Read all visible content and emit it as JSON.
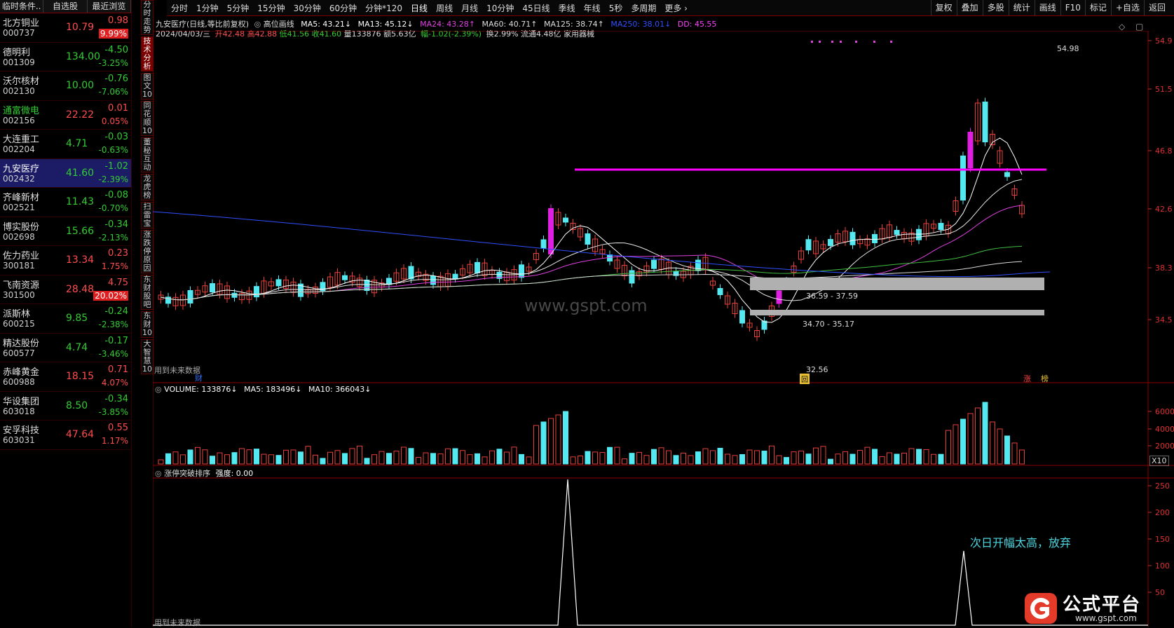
{
  "watchlist": {
    "tabs": [
      "临时条件..",
      "自选股",
      "最近浏览"
    ],
    "rows": [
      {
        "name": "北方铜业",
        "code": "000737",
        "price": "10.79",
        "change": "0.98",
        "pct": "9.99%",
        "dir": "up",
        "pct_highlight": true
      },
      {
        "name": "德明利",
        "code": "001309",
        "price": "134.00",
        "change": "-4.50",
        "pct": "-3.25%",
        "dir": "dn"
      },
      {
        "name": "沃尔核材",
        "code": "002130",
        "price": "10.00",
        "change": "-0.76",
        "pct": "-7.06%",
        "dir": "dn"
      },
      {
        "name": "通富微电",
        "code": "002156",
        "price": "22.22",
        "change": "0.01",
        "pct": "0.05%",
        "dir": "up",
        "name_green": true
      },
      {
        "name": "大连重工",
        "code": "002204",
        "price": "4.71",
        "change": "-0.03",
        "pct": "-0.63%",
        "dir": "dn"
      },
      {
        "name": "九安医疗",
        "code": "002432",
        "price": "41.60",
        "change": "-1.02",
        "pct": "-2.39%",
        "dir": "dn",
        "selected": true
      },
      {
        "name": "齐峰新材",
        "code": "002521",
        "price": "11.43",
        "change": "-0.08",
        "pct": "-0.70%",
        "dir": "dn"
      },
      {
        "name": "博实股份",
        "code": "002698",
        "price": "15.66",
        "change": "-0.34",
        "pct": "-2.13%",
        "dir": "dn"
      },
      {
        "name": "佐力药业",
        "code": "300181",
        "price": "13.34",
        "change": "0.23",
        "pct": "1.75%",
        "dir": "up"
      },
      {
        "name": "飞南资源",
        "code": "301500",
        "price": "28.48",
        "change": "4.75",
        "pct": "20.02%",
        "dir": "up",
        "pct_highlight": true
      },
      {
        "name": "派斯林",
        "code": "600215",
        "price": "9.85",
        "change": "-0.24",
        "pct": "-2.38%",
        "dir": "dn"
      },
      {
        "name": "精达股份",
        "code": "600577",
        "price": "4.74",
        "change": "-0.17",
        "pct": "-3.46%",
        "dir": "dn"
      },
      {
        "name": "赤峰黄金",
        "code": "600988",
        "price": "18.15",
        "change": "0.71",
        "pct": "4.07%",
        "dir": "up"
      },
      {
        "name": "华设集团",
        "code": "603018",
        "price": "8.50",
        "change": "-0.34",
        "pct": "-3.85%",
        "dir": "dn"
      },
      {
        "name": "安孚科技",
        "code": "603031",
        "price": "47.64",
        "change": "0.55",
        "pct": "1.17%",
        "dir": "up"
      }
    ]
  },
  "sidetabs": [
    {
      "label": "分时走势",
      "active": false
    },
    {
      "label": "技术分析",
      "active": true
    },
    {
      "label": "图文10",
      "active": false
    },
    {
      "label": "同花顺10",
      "active": false
    },
    {
      "label": "董秘互动",
      "active": false
    },
    {
      "label": "龙虎榜",
      "active": false
    },
    {
      "label": "扫雷宝",
      "active": false
    },
    {
      "label": "涨跌停原因",
      "active": false
    },
    {
      "label": "东财股吧",
      "active": false
    },
    {
      "label": "东财10",
      "active": false
    },
    {
      "label": "大智慧10",
      "active": false
    }
  ],
  "toolbar": {
    "periods": [
      "分时",
      "1分钟",
      "5分钟",
      "15分钟",
      "30分钟",
      "60分钟",
      "分钟*120",
      "日线",
      "周线",
      "月线",
      "10分钟",
      "45日线",
      "季线",
      "年线",
      "5秒",
      "多周期",
      "更多 ›"
    ],
    "active_period": "日线",
    "right": [
      "复权",
      "叠加",
      "多股",
      "统计",
      "画线",
      "F10",
      "标记",
      "+自选",
      "返回"
    ]
  },
  "header": {
    "stock_line": "九安医疗(日线,等比前复权)",
    "indicator_name": "高位画线",
    "ma5": "MA5: 43.21↓",
    "ma13": "MA13: 45.12↓",
    "ma24": "MA24: 43.28↑",
    "ma60": "MA60: 40.71↑",
    "ma125": "MA125: 38.74↑",
    "ma250": "MA250: 38.01↓",
    "dd": "DD: 45.55",
    "date": "2024/04/03/三",
    "open": "开42.48",
    "high": "高42.88",
    "low": "低41.56",
    "close": "收41.60",
    "volume": "量133876",
    "amount": "额5.63亿",
    "range": "幅-1.02(-2.39%)",
    "turnover": "换2.99%",
    "float_cap": "流通4.48亿",
    "industry": "家用器械"
  },
  "price_panel": {
    "yticks": [
      "54.9",
      "51.5",
      "46.8",
      "42.6",
      "38.3",
      "34.5"
    ],
    "high_label": "54.98",
    "low_label": "32.56",
    "zone1": "36.59 - 37.59",
    "zone2": "34.70 - 35.17",
    "future_note": "用到未来数据",
    "markers": {
      "cai": "财",
      "hui": "回",
      "zhang": "涨",
      "bang": "榜"
    },
    "watermark": "www.gspt.com"
  },
  "volume_panel": {
    "label": "VOLUME: 133876↓",
    "ma5": "MA5: 183496↓",
    "ma10": "MA10: 366043↓",
    "yticks": [
      "6000",
      "4000",
      "2000"
    ],
    "unit": "X10"
  },
  "indicator_panel": {
    "label": "涨停突破排序",
    "strength": "强度: 0.00",
    "yticks": [
      "250",
      "200",
      "150",
      "100",
      "50"
    ],
    "note": "次日开幅太高，放弃",
    "future_note": "用到未来数据"
  },
  "logo": {
    "text": "公式平台",
    "url": "www.gspt.com"
  },
  "colors": {
    "up": "#ff4d4d",
    "down": "#33cc33",
    "candle_up": "#e8403a",
    "candle_down": "#54e8f0",
    "ma5": "#ffffff",
    "ma13": "#e5e5e5",
    "ma24": "#e040e0",
    "ma60": "#40c040",
    "ma125": "#d8d8d8",
    "ma250": "#3050ff",
    "dd": "#ff00ff"
  }
}
